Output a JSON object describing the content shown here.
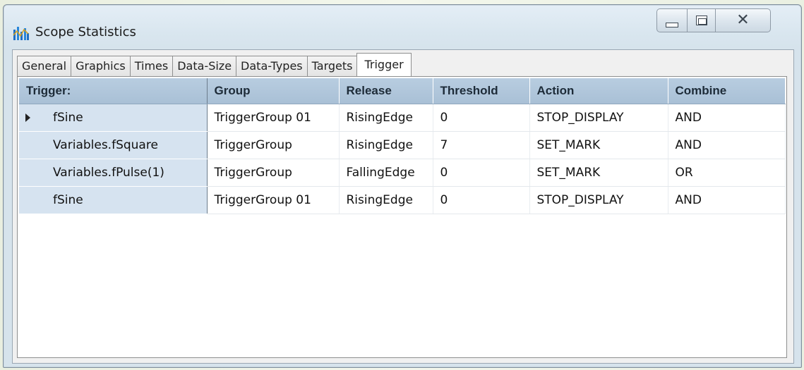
{
  "window": {
    "title": "Scope Statistics",
    "icon": "bar-chart-icon",
    "buttons": {
      "minimize": "minimize-icon",
      "maximize": "maximize-icon",
      "close": "close-icon"
    }
  },
  "tabs": [
    {
      "label": "General",
      "active": false
    },
    {
      "label": "Graphics",
      "active": false
    },
    {
      "label": "Times",
      "active": false
    },
    {
      "label": "Data-Size",
      "active": false
    },
    {
      "label": "Data-Types",
      "active": false
    },
    {
      "label": "Targets",
      "active": false
    },
    {
      "label": "Trigger",
      "active": true
    }
  ],
  "grid": {
    "columns": [
      "Trigger:",
      "Group",
      "Release",
      "Threshold",
      "Action",
      "Combine"
    ],
    "rows": [
      {
        "trigger": "fSine",
        "group": "TriggerGroup 01",
        "release": "RisingEdge",
        "threshold": "0",
        "action": "STOP_DISPLAY",
        "combine": "AND",
        "selected": true
      },
      {
        "trigger": "Variables.fSquare",
        "group": "TriggerGroup",
        "release": "RisingEdge",
        "threshold": "7",
        "action": "SET_MARK",
        "combine": "AND",
        "selected": false
      },
      {
        "trigger": "Variables.fPulse(1)",
        "group": "TriggerGroup",
        "release": "FallingEdge",
        "threshold": "0",
        "action": "SET_MARK",
        "combine": "OR",
        "selected": false
      },
      {
        "trigger": "fSine",
        "group": "TriggerGroup 01",
        "release": "RisingEdge",
        "threshold": "0",
        "action": "STOP_DISPLAY",
        "combine": "AND",
        "selected": false
      }
    ]
  },
  "colors": {
    "header_bg": "#b0c6dc",
    "row_header_bg": "#d6e3f0",
    "icon_blue": "#1f6fc5"
  }
}
